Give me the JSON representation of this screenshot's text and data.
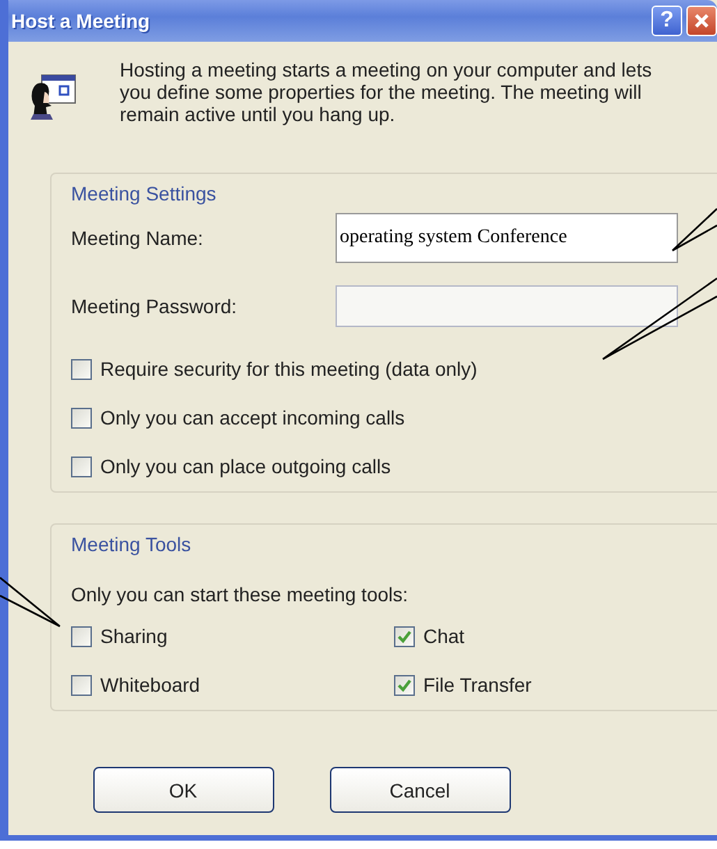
{
  "window": {
    "title": "Host a Meeting",
    "help_button": "?"
  },
  "intro": "Hosting a meeting starts a meeting on your computer and lets you define some properties for the meeting.  The meeting will remain active until you hang up.",
  "meeting_settings": {
    "title": "Meeting Settings",
    "fields": [
      {
        "label": "Meeting Name:",
        "value": "operating system Conference"
      },
      {
        "label": "Meeting Password:"
      }
    ],
    "options": [
      {
        "label": "Require security for this meeting (data only)",
        "checked": false
      },
      {
        "label": "Only you can accept incoming calls",
        "checked": false
      },
      {
        "label": "Only you can place outgoing calls",
        "checked": false
      }
    ]
  },
  "meeting_tools": {
    "title": "Meeting Tools",
    "caption": "Only you can start these meeting tools:",
    "tools": [
      {
        "label": "Sharing",
        "checked": false
      },
      {
        "label": "Chat",
        "checked": true
      },
      {
        "label": "Whiteboard",
        "checked": false
      },
      {
        "label": "File Transfer",
        "checked": true
      }
    ]
  },
  "buttons": [
    {
      "label": "OK"
    },
    {
      "label": "Cancel"
    }
  ]
}
